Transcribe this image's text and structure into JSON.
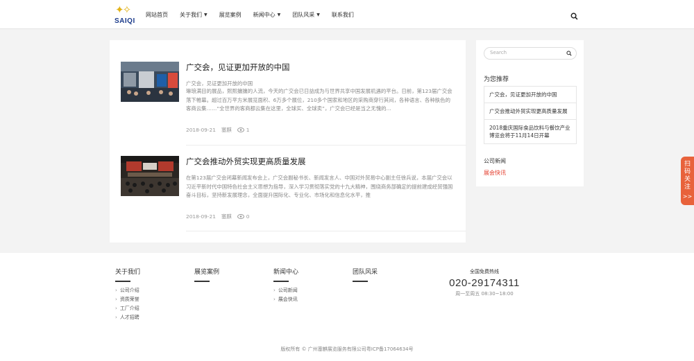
{
  "header": {
    "logo_text": "SAIQI",
    "nav": [
      {
        "label": "网站首页",
        "dropdown": false
      },
      {
        "label": "关于我们",
        "dropdown": true
      },
      {
        "label": "展览案例",
        "dropdown": false
      },
      {
        "label": "新闻中心",
        "dropdown": true
      },
      {
        "label": "团队风采",
        "dropdown": true
      },
      {
        "label": "联系我们",
        "dropdown": false
      }
    ]
  },
  "articles": [
    {
      "title": "广交会，见证更加开放的中国",
      "subtitle": "广交会，见证更加开放的中国",
      "body": "琳琅满目的展品，熙熙攘攘的人流，今天的广交会已日益成为与世界共享中国发展机遇的平台。日前，第123届广交会落下帷幕。超过百万平方米展览面积、6万多个展位，210多个国家和地区的采购商穿行其间，各种语言、各种肤色的客商云集……“全世界的客商都云集在这里，全球买、全球卖”，广交会已经是当之无愧的…",
      "date": "2018-09-21",
      "author": "塞麒",
      "views": "1"
    },
    {
      "title": "广交会推动外贸实现更高质量发展",
      "subtitle": "",
      "body": "在第123届广交会闭幕新闻发布会上，广交会副秘书长、新闻发言人、中国对外贸易中心副主任徐兵说，本届广交会以习近平新时代中国特色社会主义思想为指导，深入学习贯彻落实党的十九大精神，围绕商务部确定的提前建成经贸强国奋斗目标，坚持新发展理念，全面提升国际化、专业化、市场化和信息化水平，推",
      "date": "2018-09-21",
      "author": "塞麒",
      "views": "0"
    }
  ],
  "sidebar": {
    "search_placeholder": "Search",
    "recommend_title": "为您推荐",
    "recommend": [
      "广交会，见证更加开放的中国",
      "广交会推动外贸实现更高质量发展",
      "2018重庆国际食品饮料与餐饮产业博览会将于11月14日开幕"
    ],
    "categories": [
      "公司新闻",
      "展会快讯"
    ]
  },
  "float_tab": {
    "label": "扫码关注",
    "arrow": ">>"
  },
  "footer": {
    "columns": [
      {
        "title": "关于我们",
        "links": [
          "公司介绍",
          "资质荣誉",
          "工厂介绍",
          "人才招聘"
        ]
      },
      {
        "title": "展览案例",
        "links": []
      },
      {
        "title": "新闻中心",
        "links": [
          "公司新闻",
          "展会快讯"
        ]
      },
      {
        "title": "团队风采",
        "links": []
      }
    ],
    "hotline_label": "全国免费热线",
    "hotline_number": "020-29174311",
    "hotline_hours": "周一至周五 08:30~18:00",
    "copyright": "版权所有 © 广州塞麒展览服务有限公司粤ICP备17064634号"
  },
  "colors": {
    "accent": "#e43c2c",
    "float_tab": "#e8623b",
    "logo_gold": "#e2b31a",
    "logo_blue": "#1a3a8a"
  }
}
